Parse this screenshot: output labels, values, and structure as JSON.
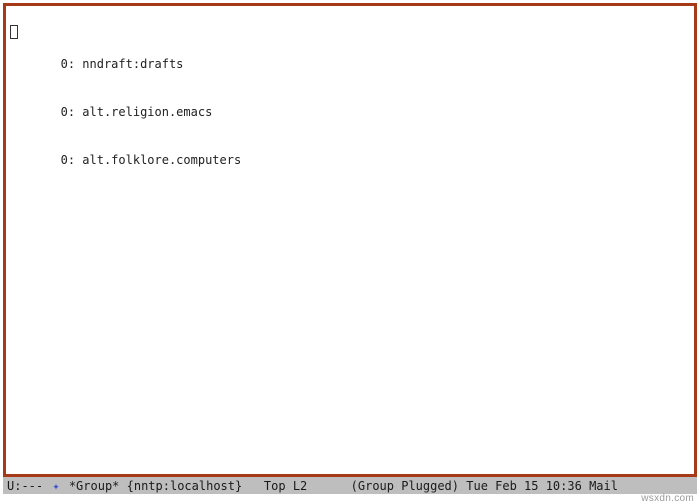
{
  "groups": [
    {
      "count": "0",
      "name": "nndraft:drafts"
    },
    {
      "count": "0",
      "name": "alt.religion.emacs"
    },
    {
      "count": "0",
      "name": "alt.folklore.computers"
    }
  ],
  "separator": ": ",
  "modeline": {
    "status": "U:--- ",
    "icon_glyph": "✦",
    "buffer_name": " *Group* ",
    "server": "{nntp:localhost}",
    "spacer1": "   ",
    "position": "Top",
    "line": " L2",
    "spacer2": "      ",
    "minor": "(Group Plugged)",
    "time": " Tue Feb 15 10:36 ",
    "tail": "Mail"
  },
  "watermark": "wsxdn.com"
}
